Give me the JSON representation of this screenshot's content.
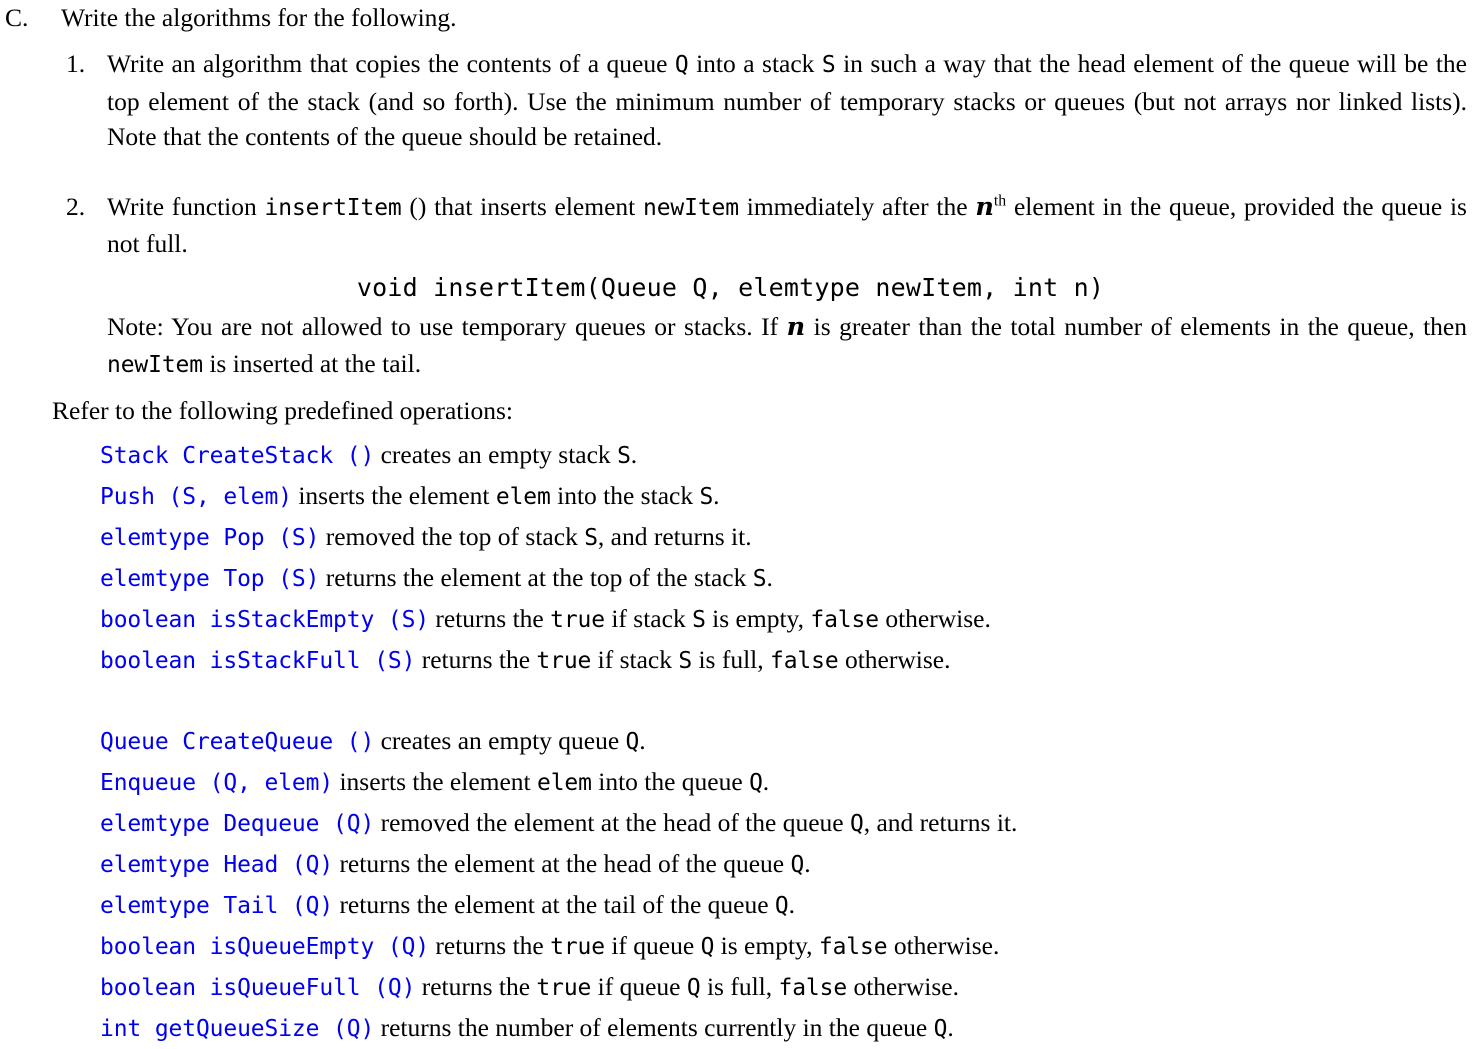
{
  "document": {
    "section": {
      "label": "C.",
      "title": "Write the algorithms for the following."
    },
    "items": [
      {
        "number": "1.",
        "text_parts": {
          "p1": "Write an algorithm that copies the contents of a queue ",
          "code1": "Q",
          "p2": " into a stack ",
          "code2": "S",
          "p3": " in such a way that the head element of the queue will be the top element of the stack (and so forth). Use the minimum number of temporary stacks or queues (but not arrays nor linked lists). Note that the contents of the queue should be retained."
        }
      },
      {
        "number": "2.",
        "text_parts": {
          "p1": "Write function ",
          "code1": "insertItem",
          "p2": " () that inserts element ",
          "code2": "newItem",
          "p3": " immediately after the ",
          "math1": "n",
          "sup1": "th",
          "p4": " element in the queue, provided the queue is not full."
        },
        "signature": "void insertItem(Queue Q, elemtype newItem, int n)",
        "note_parts": {
          "p1": "Note: You are not allowed to use temporary queues or stacks. If ",
          "math1": "n",
          "p2": " is greater than the total number of elements in the queue, then ",
          "code1": "newItem",
          "p3": " is inserted at the tail."
        }
      }
    ],
    "refer_text": "Refer to the following predefined operations:",
    "stack_operations": [
      {
        "signature": "Stack CreateStack ()",
        "parts": [
          {
            "kind": "text",
            "value": " creates an empty stack "
          },
          {
            "kind": "code",
            "value": "S"
          },
          {
            "kind": "text",
            "value": "."
          }
        ]
      },
      {
        "signature": "Push (S, elem)",
        "parts": [
          {
            "kind": "text",
            "value": " inserts the element "
          },
          {
            "kind": "code",
            "value": "elem"
          },
          {
            "kind": "text",
            "value": " into the stack "
          },
          {
            "kind": "code",
            "value": "S"
          },
          {
            "kind": "text",
            "value": "."
          }
        ]
      },
      {
        "signature": "elemtype Pop (S)",
        "parts": [
          {
            "kind": "text",
            "value": " removed the top of stack "
          },
          {
            "kind": "code",
            "value": "S"
          },
          {
            "kind": "text",
            "value": ", and returns it."
          }
        ]
      },
      {
        "signature": "elemtype Top (S)",
        "parts": [
          {
            "kind": "text",
            "value": " returns the element at the top of the stack "
          },
          {
            "kind": "code",
            "value": "S"
          },
          {
            "kind": "text",
            "value": "."
          }
        ]
      },
      {
        "signature": "boolean isStackEmpty (S)",
        "parts": [
          {
            "kind": "text",
            "value": " returns the "
          },
          {
            "kind": "code",
            "value": "true"
          },
          {
            "kind": "text",
            "value": " if stack "
          },
          {
            "kind": "code",
            "value": "S"
          },
          {
            "kind": "text",
            "value": " is empty, "
          },
          {
            "kind": "code",
            "value": "false"
          },
          {
            "kind": "text",
            "value": " otherwise."
          }
        ]
      },
      {
        "signature": "boolean isStackFull (S)",
        "parts": [
          {
            "kind": "text",
            "value": " returns the "
          },
          {
            "kind": "code",
            "value": "true"
          },
          {
            "kind": "text",
            "value": " if stack "
          },
          {
            "kind": "code",
            "value": "S"
          },
          {
            "kind": "text",
            "value": " is full, "
          },
          {
            "kind": "code",
            "value": "false"
          },
          {
            "kind": "text",
            "value": " otherwise."
          }
        ]
      }
    ],
    "queue_operations": [
      {
        "signature": "Queue CreateQueue ()",
        "parts": [
          {
            "kind": "text",
            "value": " creates an empty queue "
          },
          {
            "kind": "code",
            "value": "Q"
          },
          {
            "kind": "text",
            "value": "."
          }
        ]
      },
      {
        "signature": "Enqueue (Q, elem)",
        "parts": [
          {
            "kind": "text",
            "value": " inserts the element "
          },
          {
            "kind": "code",
            "value": "elem"
          },
          {
            "kind": "text",
            "value": " into the queue "
          },
          {
            "kind": "code",
            "value": "Q"
          },
          {
            "kind": "text",
            "value": "."
          }
        ]
      },
      {
        "signature": "elemtype Dequeue (Q)",
        "parts": [
          {
            "kind": "text",
            "value": " removed the element at the head of the queue "
          },
          {
            "kind": "code",
            "value": "Q"
          },
          {
            "kind": "text",
            "value": ", and returns it."
          }
        ]
      },
      {
        "signature": "elemtype Head (Q)",
        "parts": [
          {
            "kind": "text",
            "value": " returns the element at the head of the queue "
          },
          {
            "kind": "code",
            "value": "Q"
          },
          {
            "kind": "text",
            "value": "."
          }
        ]
      },
      {
        "signature": "elemtype Tail (Q)",
        "parts": [
          {
            "kind": "text",
            "value": " returns the element at the tail of the queue "
          },
          {
            "kind": "code",
            "value": "Q"
          },
          {
            "kind": "text",
            "value": "."
          }
        ]
      },
      {
        "signature": "boolean isQueueEmpty (Q)",
        "parts": [
          {
            "kind": "text",
            "value": " returns the "
          },
          {
            "kind": "code",
            "value": "true"
          },
          {
            "kind": "text",
            "value": " if queue "
          },
          {
            "kind": "code",
            "value": "Q"
          },
          {
            "kind": "text",
            "value": " is empty, "
          },
          {
            "kind": "code",
            "value": "false"
          },
          {
            "kind": "text",
            "value": " otherwise."
          }
        ]
      },
      {
        "signature": "boolean isQueueFull (Q)",
        "parts": [
          {
            "kind": "text",
            "value": " returns the "
          },
          {
            "kind": "code",
            "value": "true"
          },
          {
            "kind": "text",
            "value": " if queue "
          },
          {
            "kind": "code",
            "value": "Q"
          },
          {
            "kind": "text",
            "value": " is full, "
          },
          {
            "kind": "code",
            "value": "false"
          },
          {
            "kind": "text",
            "value": " otherwise."
          }
        ]
      },
      {
        "signature": "int getQueueSize (Q)",
        "parts": [
          {
            "kind": "text",
            "value": " returns the number of elements currently in the queue "
          },
          {
            "kind": "code",
            "value": "Q"
          },
          {
            "kind": "text",
            "value": "."
          }
        ]
      }
    ]
  },
  "colors": {
    "signature_blue": "#0000ee",
    "body_black": "#000000",
    "page_background": "#ffffff"
  }
}
